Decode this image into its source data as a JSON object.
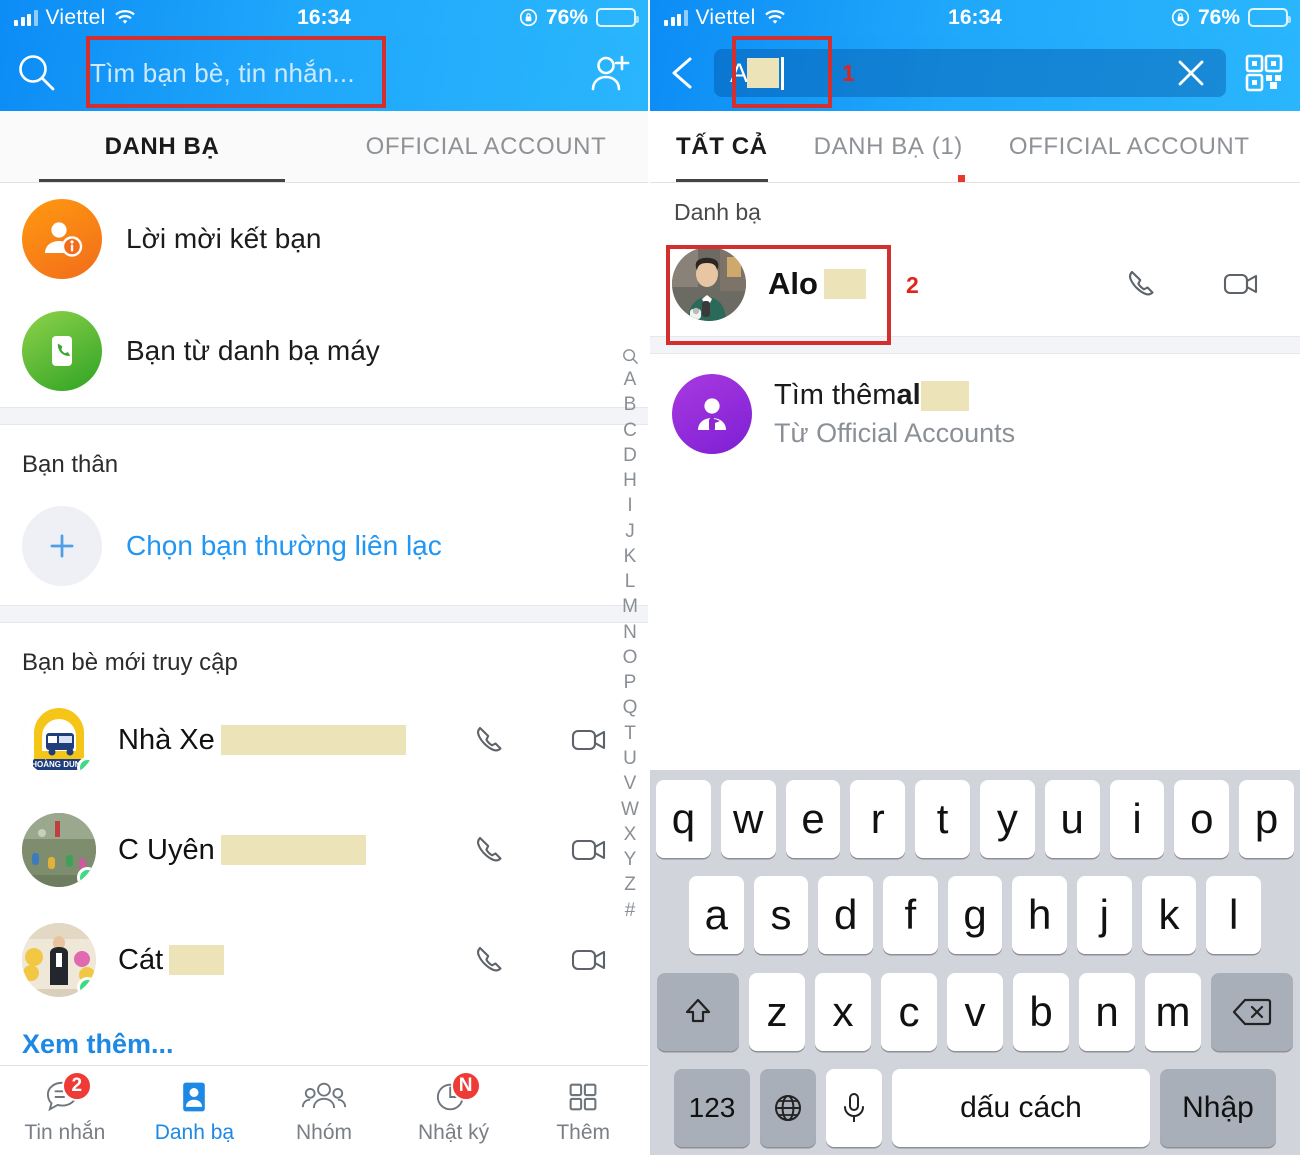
{
  "status_bar": {
    "carrier": "Viettel",
    "time": "16:34",
    "battery_percent": "76%",
    "battery_level": 76,
    "icons": [
      "signal-bars-icon",
      "wifi-icon",
      "rotation-lock-icon",
      "battery-icon"
    ]
  },
  "left_screen": {
    "search": {
      "placeholder": "Tìm bạn bè, tin nhắn...",
      "value": "",
      "search_icon": "search-icon",
      "add_friend_icon": "add-friend-icon"
    },
    "tabs": [
      {
        "label": "DANH BẠ",
        "active": true
      },
      {
        "label": "OFFICIAL ACCOUNT",
        "active": false
      }
    ],
    "menu_items": [
      {
        "label": "Lời mời kết bạn",
        "icon": "friend-request-icon",
        "color": "#f57c1b"
      },
      {
        "label": "Bạn từ danh bạ máy",
        "icon": "phonebook-icon",
        "color": "#4caf50"
      }
    ],
    "favorites": {
      "title": "Bạn thân",
      "add_label": "Chọn bạn thường liên lạc",
      "add_icon": "plus-icon"
    },
    "recent": {
      "title": "Bạn bè mới truy cập",
      "contacts": [
        {
          "name": "Nhà Xe",
          "redacted_width": 185,
          "avatar": "bus-logo-avatar",
          "online": true,
          "call_icon": "phone-icon",
          "video_icon": "video-camera-icon"
        },
        {
          "name": "C Uyên",
          "redacted_width": 145,
          "avatar": "playground-photo-avatar",
          "online": true,
          "call_icon": "phone-icon",
          "video_icon": "video-camera-icon"
        },
        {
          "name": "Cát",
          "redacted_width": 55,
          "avatar": "man-suit-photo-avatar",
          "online": true,
          "call_icon": "phone-icon",
          "video_icon": "video-camera-icon"
        }
      ],
      "see_more": "Xem thêm..."
    },
    "alphabet_index": [
      "A",
      "B",
      "C",
      "D",
      "H",
      "I",
      "J",
      "K",
      "L",
      "M",
      "N",
      "O",
      "P",
      "Q",
      "T",
      "U",
      "V",
      "W",
      "X",
      "Y",
      "Z",
      "#"
    ],
    "alphabet_index_search_icon": "search-icon",
    "bottom_nav": [
      {
        "label": "Tin nhắn",
        "icon": "chat-bubble-icon",
        "badge": "2",
        "active": false
      },
      {
        "label": "Danh bạ",
        "icon": "contacts-card-icon",
        "badge": "",
        "active": true
      },
      {
        "label": "Nhóm",
        "icon": "group-people-icon",
        "badge": "",
        "active": false
      },
      {
        "label": "Nhật ký",
        "icon": "clock-diary-icon",
        "badge": "N",
        "active": false
      },
      {
        "label": "Thêm",
        "icon": "grid-more-icon",
        "badge": "",
        "active": false
      }
    ]
  },
  "right_screen": {
    "search": {
      "value": "Alo",
      "value_visible": "Alo",
      "redacted_width": 32,
      "back_icon": "back-chevron-icon",
      "clear_icon": "close-x-icon",
      "qr_icon": "qr-code-icon"
    },
    "tabs": [
      {
        "label": "TẤT CẢ",
        "active": true
      },
      {
        "label": "DANH BẠ (1)",
        "active": false
      },
      {
        "label": "OFFICIAL ACCOUNT",
        "active": false
      }
    ],
    "results": {
      "section_label": "Danh bạ",
      "contact": {
        "name": "Alo",
        "redacted_width": 42,
        "avatar": "man-portrait-avatar",
        "call_icon": "phone-icon",
        "video_icon": "video-camera-icon"
      },
      "official": {
        "title_prefix": "Tìm thêm ",
        "title_query": "al",
        "redacted_width": 48,
        "subtitle": "Từ Official Accounts",
        "icon": "official-account-search-icon"
      }
    },
    "annotations": [
      {
        "number": "1",
        "target": "search-field"
      },
      {
        "number": "2",
        "target": "contact-result"
      }
    ],
    "keyboard": {
      "row1": [
        "q",
        "w",
        "e",
        "r",
        "t",
        "y",
        "u",
        "i",
        "o",
        "p"
      ],
      "row2": [
        "a",
        "s",
        "d",
        "f",
        "g",
        "h",
        "j",
        "k",
        "l"
      ],
      "row3_shift": "shift-icon",
      "row3": [
        "z",
        "x",
        "c",
        "v",
        "b",
        "n",
        "m"
      ],
      "row3_backspace": "backspace-icon",
      "numbers_key": "123",
      "globe_key": "globe-icon",
      "mic_key": "microphone-icon",
      "space_key": "dấu cách",
      "enter_key": "Nhập"
    }
  },
  "colors": {
    "header_blue_start": "#0c8cf5",
    "header_blue_end": "#2ab6fd",
    "accent_blue": "#1e88e5",
    "annotation_red": "#d32f2f",
    "badge_red": "#ef3b36",
    "online_green": "#3ddc84",
    "redact_tan": "#ece3b8",
    "battery_yellow": "#ffcc00"
  }
}
